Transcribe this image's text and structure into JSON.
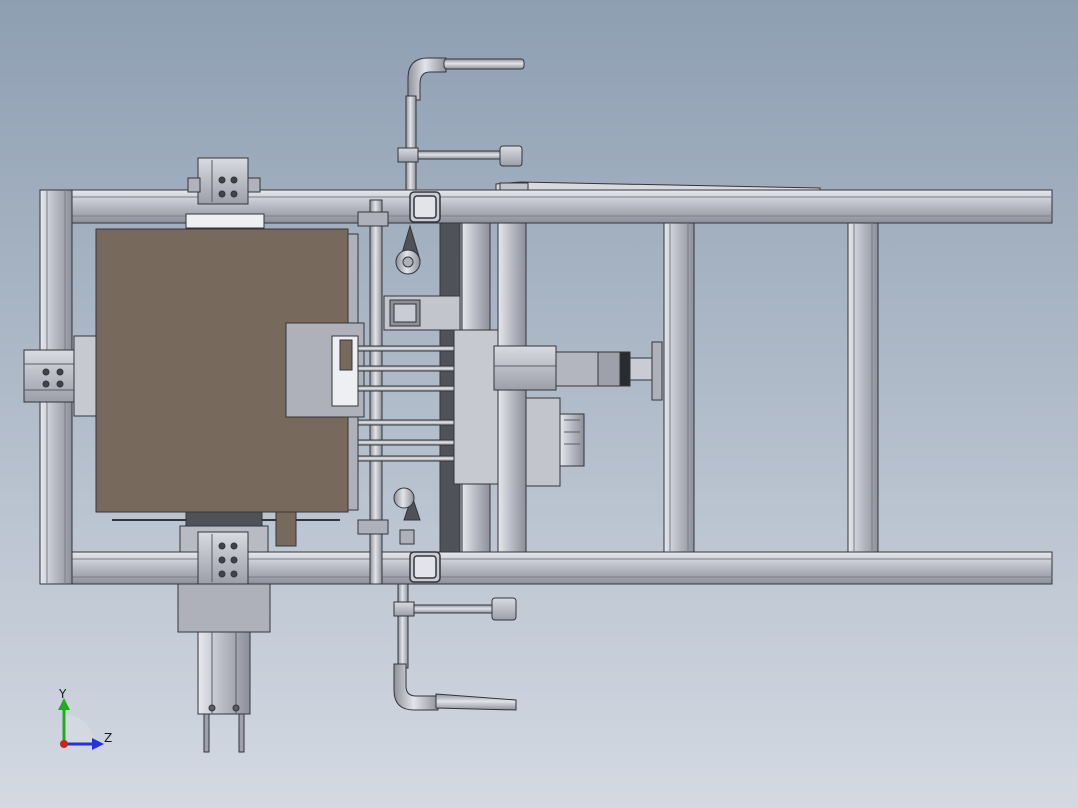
{
  "viewport": {
    "background_top": "#8e9fb2",
    "background_bottom": "#d4d9e2"
  },
  "colors": {
    "metal": "#c9ccd4",
    "metal_dark": "#8d909a",
    "edge": "#34353b",
    "plate": "#776a5c",
    "tube": "#b3b6be",
    "dark": "#50525a"
  },
  "triad": {
    "y_label": "Y",
    "z_label": "Z",
    "y_color": "#22aa22",
    "z_color": "#2233dd",
    "x_color": "#cc2222"
  }
}
